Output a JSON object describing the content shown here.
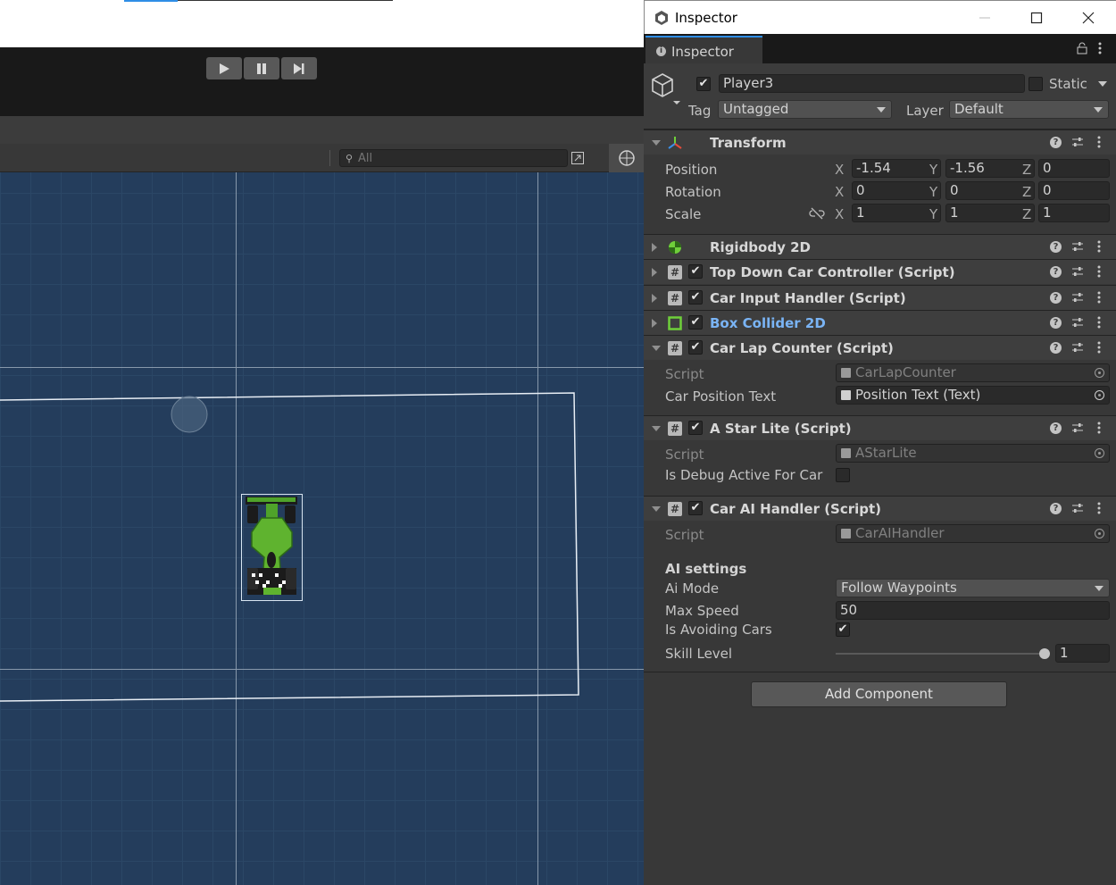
{
  "scene": {
    "search_placeholder": "All"
  },
  "window": {
    "title": "Inspector"
  },
  "tab": {
    "label": "Inspector"
  },
  "gameobject": {
    "name": "Player3",
    "active": true,
    "static_label": "Static",
    "static_checked": false,
    "tag_label": "Tag",
    "tag_value": "Untagged",
    "layer_label": "Layer",
    "layer_value": "Default"
  },
  "transform": {
    "name": "Transform",
    "position_label": "Position",
    "rotation_label": "Rotation",
    "scale_label": "Scale",
    "axes": {
      "x": "X",
      "y": "Y",
      "z": "Z"
    },
    "position": {
      "x": "-1.54",
      "y": "-1.56",
      "z": "0"
    },
    "rotation": {
      "x": "0",
      "y": "0",
      "z": "0"
    },
    "scale": {
      "x": "1",
      "y": "1",
      "z": "1"
    }
  },
  "components": {
    "rigidbody": {
      "name": "Rigidbody 2D"
    },
    "top_down": {
      "name": "Top Down Car Controller (Script)"
    },
    "input_handler": {
      "name": "Car Input Handler (Script)"
    },
    "box_collider": {
      "name": "Box Collider 2D"
    },
    "lap_counter": {
      "name": "Car Lap Counter (Script)",
      "script_label": "Script",
      "script_value": "CarLapCounter",
      "pos_text_label": "Car Position Text",
      "pos_text_value": "Position Text (Text)"
    },
    "astar": {
      "name": "A Star Lite (Script)",
      "script_label": "Script",
      "script_value": "AStarLite",
      "debug_label": "Is Debug Active For Car",
      "debug_checked": false
    },
    "ai_handler": {
      "name": "Car AI Handler (Script)",
      "script_label": "Script",
      "script_value": "CarAIHandler",
      "section_label": "AI settings",
      "mode_label": "Ai Mode",
      "mode_value": "Follow Waypoints",
      "speed_label": "Max Speed",
      "speed_value": "50",
      "avoid_label": "Is Avoiding Cars",
      "avoid_checked": true,
      "skill_label": "Skill Level",
      "skill_value": "1",
      "skill_fraction": 1.0
    }
  },
  "add_component_label": "Add Component",
  "colors": {
    "accent": "#2f8ee6",
    "panel": "#383838",
    "scene_bg": "#243d5c"
  }
}
